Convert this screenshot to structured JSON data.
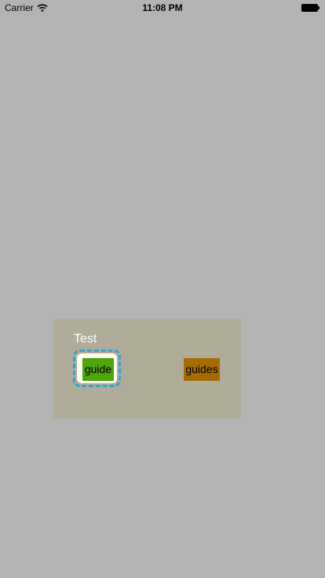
{
  "status_bar": {
    "carrier": "Carrier",
    "time": "11:08 PM"
  },
  "panel": {
    "title": "Test",
    "buttons": {
      "guide_label": "guide",
      "guides_label": "guides"
    }
  }
}
